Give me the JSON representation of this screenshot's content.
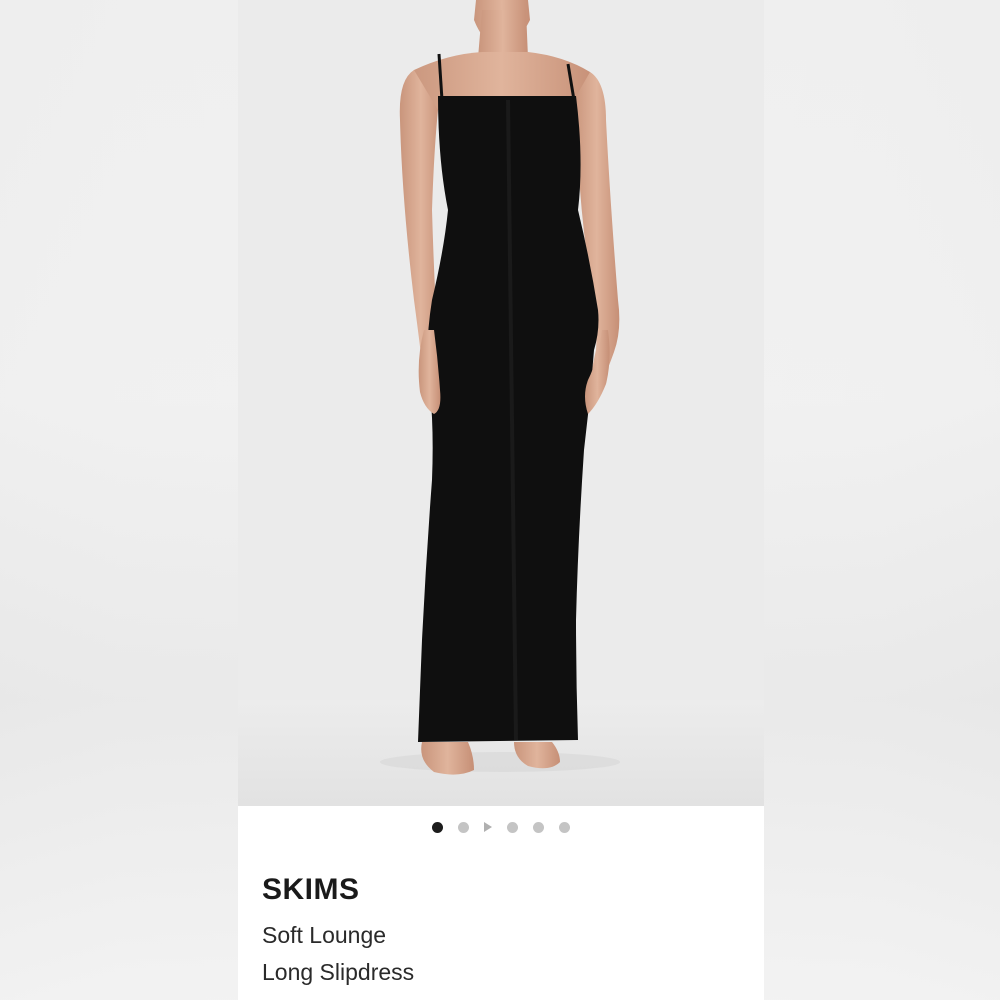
{
  "product": {
    "brand": "SKIMS",
    "name_lines": [
      "Soft Lounge",
      "Long Slipdress"
    ],
    "image": {
      "description_icon": "product-photo",
      "dress_color": "#0f0f0f",
      "background_color": "#ebebeb"
    }
  },
  "carousel": {
    "total_slides": 6,
    "active_index": 0,
    "video_slide_index": 2,
    "active_color": "#1c1c1c",
    "inactive_color": "#c4c4c4"
  }
}
